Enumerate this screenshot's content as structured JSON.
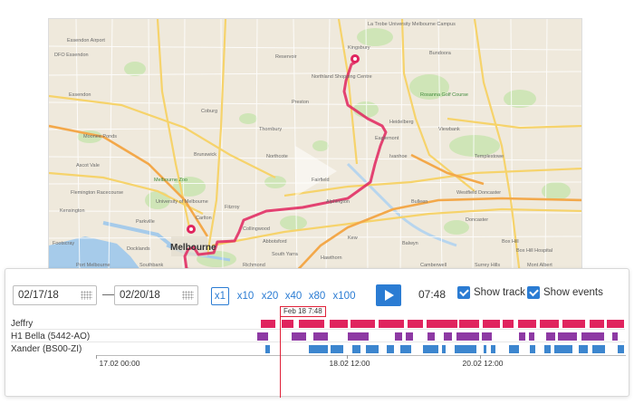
{
  "map": {
    "labels": {
      "essendon_airport": "Essendon Airport",
      "dfo_essendon": "DFO Essendon",
      "essendon": "Essendon",
      "moonee_ponds": "Moonee Ponds",
      "ascot_vale": "Ascot Vale",
      "flemington": "Flemington Racecourse",
      "melbourne_zoo": "Melbourne Zoo",
      "university": "University of Melbourne",
      "docklands": "Docklands",
      "melbourne": "Melbourne",
      "richmond": "Richmond",
      "coburg": "Coburg",
      "brunswick": "Brunswick",
      "northcote": "Northcote",
      "preston": "Preston",
      "fitzroy": "Fitzroy",
      "collingwood": "Collingwood",
      "abbotsford": "Abbotsford",
      "kew": "Kew",
      "ivanhoe": "Ivanhoe",
      "heidelberg": "Heidelberg",
      "balwyn": "Balwyn",
      "doncaster": "Doncaster",
      "box_hill": "Box Hill",
      "box_hill_hospital": "Box Hill Hospital",
      "westfield": "Westfield Doncaster",
      "bundoora": "Bundoora",
      "rosanna": "Rosanna Golf Course",
      "northland": "Northland Shopping Centre",
      "la_trobe": "La Trobe University Melbourne Campus",
      "kingsbury": "Kingsbury",
      "viewbank": "Viewbank",
      "templestowe": "Templestowe",
      "eaglemont": "Eaglemont",
      "hawthorn": "Hawthorn",
      "camberwell": "Camberwell",
      "surrey_hills": "Surrey Hills",
      "mont_albert": "Mont Albert",
      "south_yarra": "South Yarra",
      "port_melbourne": "Port Melbourne",
      "southbank": "Southbank",
      "footscray": "Footscray",
      "kensington": "Kensington",
      "parkville": "Parkville",
      "carlton": "Carlton",
      "thornbury": "Thornbury",
      "fairfield": "Fairfield",
      "alphington": "Alphington",
      "reservoir": "Reservoir",
      "bulleen": "Bulleen"
    }
  },
  "controls": {
    "date_from": "02/17/18",
    "date_separator": "—",
    "date_to": "02/20/18",
    "speeds": [
      "x1",
      "x10",
      "x20",
      "x40",
      "x80",
      "x100"
    ],
    "time": "07:48",
    "show_track": "Show track",
    "show_events": "Show events"
  },
  "timeline": {
    "cursor_label": "Feb 18 7:48",
    "rows": [
      {
        "name": "Jeffry",
        "color": "#e0245e"
      },
      {
        "name": "H1 Bella (5442-AO)",
        "color": "#8e3aa4"
      },
      {
        "name": "Xander (BS00-ZI)",
        "color": "#3c86cf"
      }
    ],
    "ticks": [
      "17.02 00:00",
      "18.02 12:00",
      "20.02 12:00"
    ]
  },
  "colors": {
    "accent": "#2b7cd3",
    "track": "#e0245e"
  }
}
